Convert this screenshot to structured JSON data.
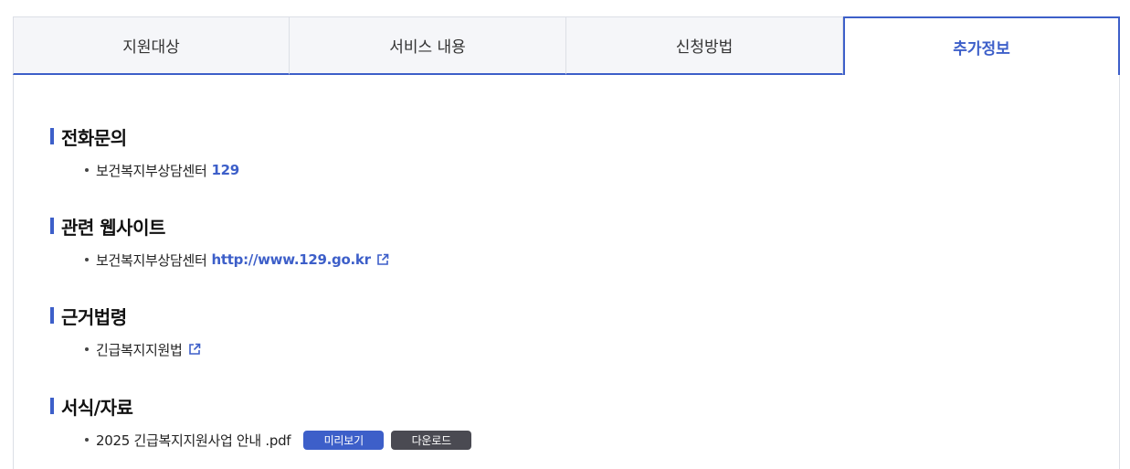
{
  "tabs": [
    {
      "label": "지원대상",
      "active": false
    },
    {
      "label": "서비스 내용",
      "active": false
    },
    {
      "label": "신청방법",
      "active": false
    },
    {
      "label": "추가정보",
      "active": true
    }
  ],
  "sections": {
    "phone": {
      "title": "전화문의",
      "item_text": "보건복지부상담센터",
      "item_value": "129"
    },
    "websites": {
      "title": "관련 웹사이트",
      "item_text": "보건복지부상담센터",
      "item_link": "http://www.129.go.kr",
      "icon": "external-link-icon"
    },
    "laws": {
      "title": "근거법령",
      "item_text": "긴급복지지원법",
      "icon": "external-link-icon"
    },
    "forms": {
      "title": "서식/자료",
      "item_text": "2025 긴급복지지원사업 안내 .pdf",
      "preview_label": "미리보기",
      "download_label": "다운로드"
    }
  },
  "colors": {
    "accent": "#3d5fc9",
    "download_button": "#4a4a52",
    "tab_background": "#f5f6f9"
  }
}
